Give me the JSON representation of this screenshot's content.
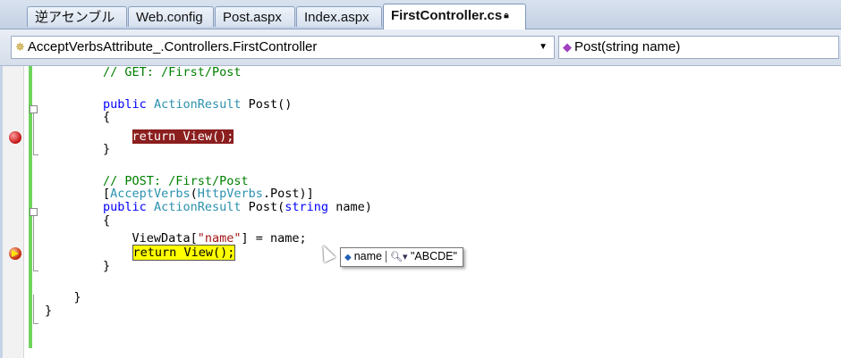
{
  "tabs": [
    {
      "label": "逆アセンブル",
      "active": false
    },
    {
      "label": "Web.config",
      "active": false
    },
    {
      "label": "Post.aspx",
      "active": false
    },
    {
      "label": "Index.aspx",
      "active": false
    },
    {
      "label": "FirstController.cs",
      "active": true
    }
  ],
  "nav": {
    "type_combo": "AcceptVerbsAttribute_.Controllers.FirstController",
    "member_combo": "Post(string name)"
  },
  "code": {
    "l1": "// GET: /First/Post",
    "l2_kw": "public",
    "l2_ty": "ActionResult",
    "l2_rest": " Post()",
    "open": "{",
    "close": "}",
    "l4_bp": "return View();",
    "l8": "// POST: /First/Post",
    "l9_a": "[",
    "l9_ty1": "AcceptVerbs",
    "l9_b": "(",
    "l9_ty2": "HttpVerbs",
    "l9_c": ".Post)]",
    "l10_kw": "public",
    "l10_ty": "ActionResult",
    "l10_mid": " Post(",
    "l10_kw2": "string",
    "l10_end": " name)",
    "l12_a": "ViewData[",
    "l12_str": "\"name\"",
    "l12_b": "] = name;",
    "l13_cur": "return View();"
  },
  "datatip": {
    "name": "name",
    "value": "\"ABCDE\""
  },
  "colors": {
    "breakpoint": "#8b1e1e",
    "current_statement": "#ffff00",
    "change_bar": "#6fd35e"
  }
}
